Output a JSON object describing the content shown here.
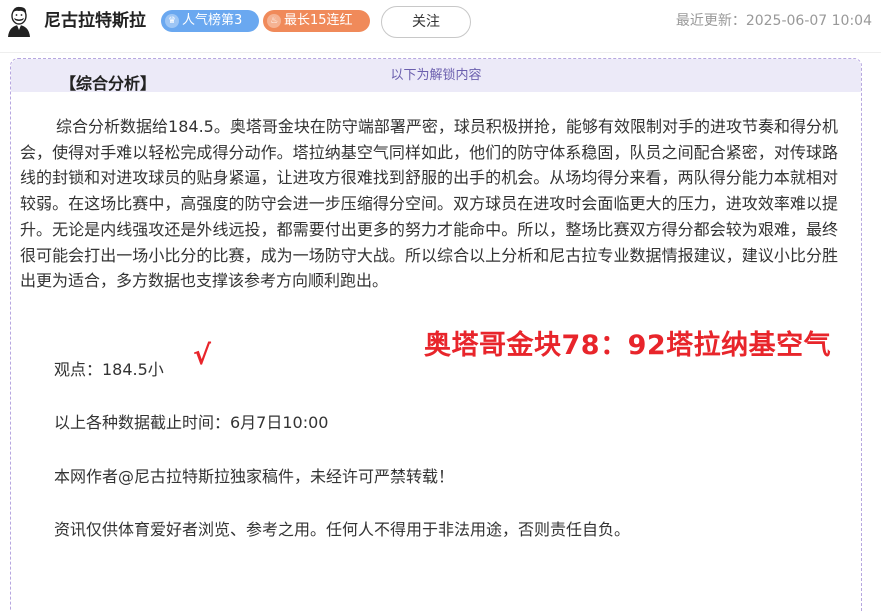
{
  "header": {
    "author_name": "尼古拉特斯拉",
    "avatar_icon": "portrait-avatar-icon",
    "badges": [
      {
        "label": "人气榜第3",
        "icon": "crown-icon",
        "color": "#6aa8f0"
      },
      {
        "label": "最长15连红",
        "icon": "flame-icon",
        "color": "#f08a5a"
      }
    ],
    "follow_label": "关注",
    "update_label": "最近更新：",
    "update_time": "2025-06-07 10:04"
  },
  "article": {
    "unlock_banner": "以下为解锁内容",
    "section_title": "【综合分析】",
    "analysis_text": "综合分析数据给184.5。奥塔哥金块在防守端部署严密，球员积极拼抢，能够有效限制对手的进攻节奏和得分机会，使得对手难以轻松完成得分动作。塔拉纳基空气同样如此，他们的防守体系稳固，队员之间配合紧密，对传球路线的封锁和对进攻球员的贴身紧逼，让进攻方很难找到舒服的出手的机会。从场均得分来看，两队得分能力本就相对较弱。在这场比赛中，高强度的防守会进一步压缩得分空间。双方球员在进攻时会面临更大的压力，进攻效率难以提升。无论是内线强攻还是外线远投，都需要付出更多的努力才能命中。所以，整场比赛双方得分都会较为艰难，最终很可能会打出一场小比分的比赛，成为一场防守大战。所以综合以上分析和尼古拉专业数据情报建议，建议小比分胜出更为适合，多方数据也支撑该参考方向顺利跑出。",
    "viewpoint": "观点：184.5小",
    "check_mark": "√",
    "final_score": "奥塔哥金块78：92塔拉纳基空气",
    "data_cutoff": "以上各种数据截止时间：6月7日10:00",
    "copyright": "本网作者@尼古拉特斯拉独家稿件，未经许可严禁转载！",
    "disclaimer": "资讯仅供体育爱好者浏览、参考之用。任何人不得用于非法用途，否则责任自负。"
  },
  "colors": {
    "accent_red": "#e8252b",
    "unlock_bg": "#eceaf8",
    "unlock_text": "#6b5fae"
  }
}
